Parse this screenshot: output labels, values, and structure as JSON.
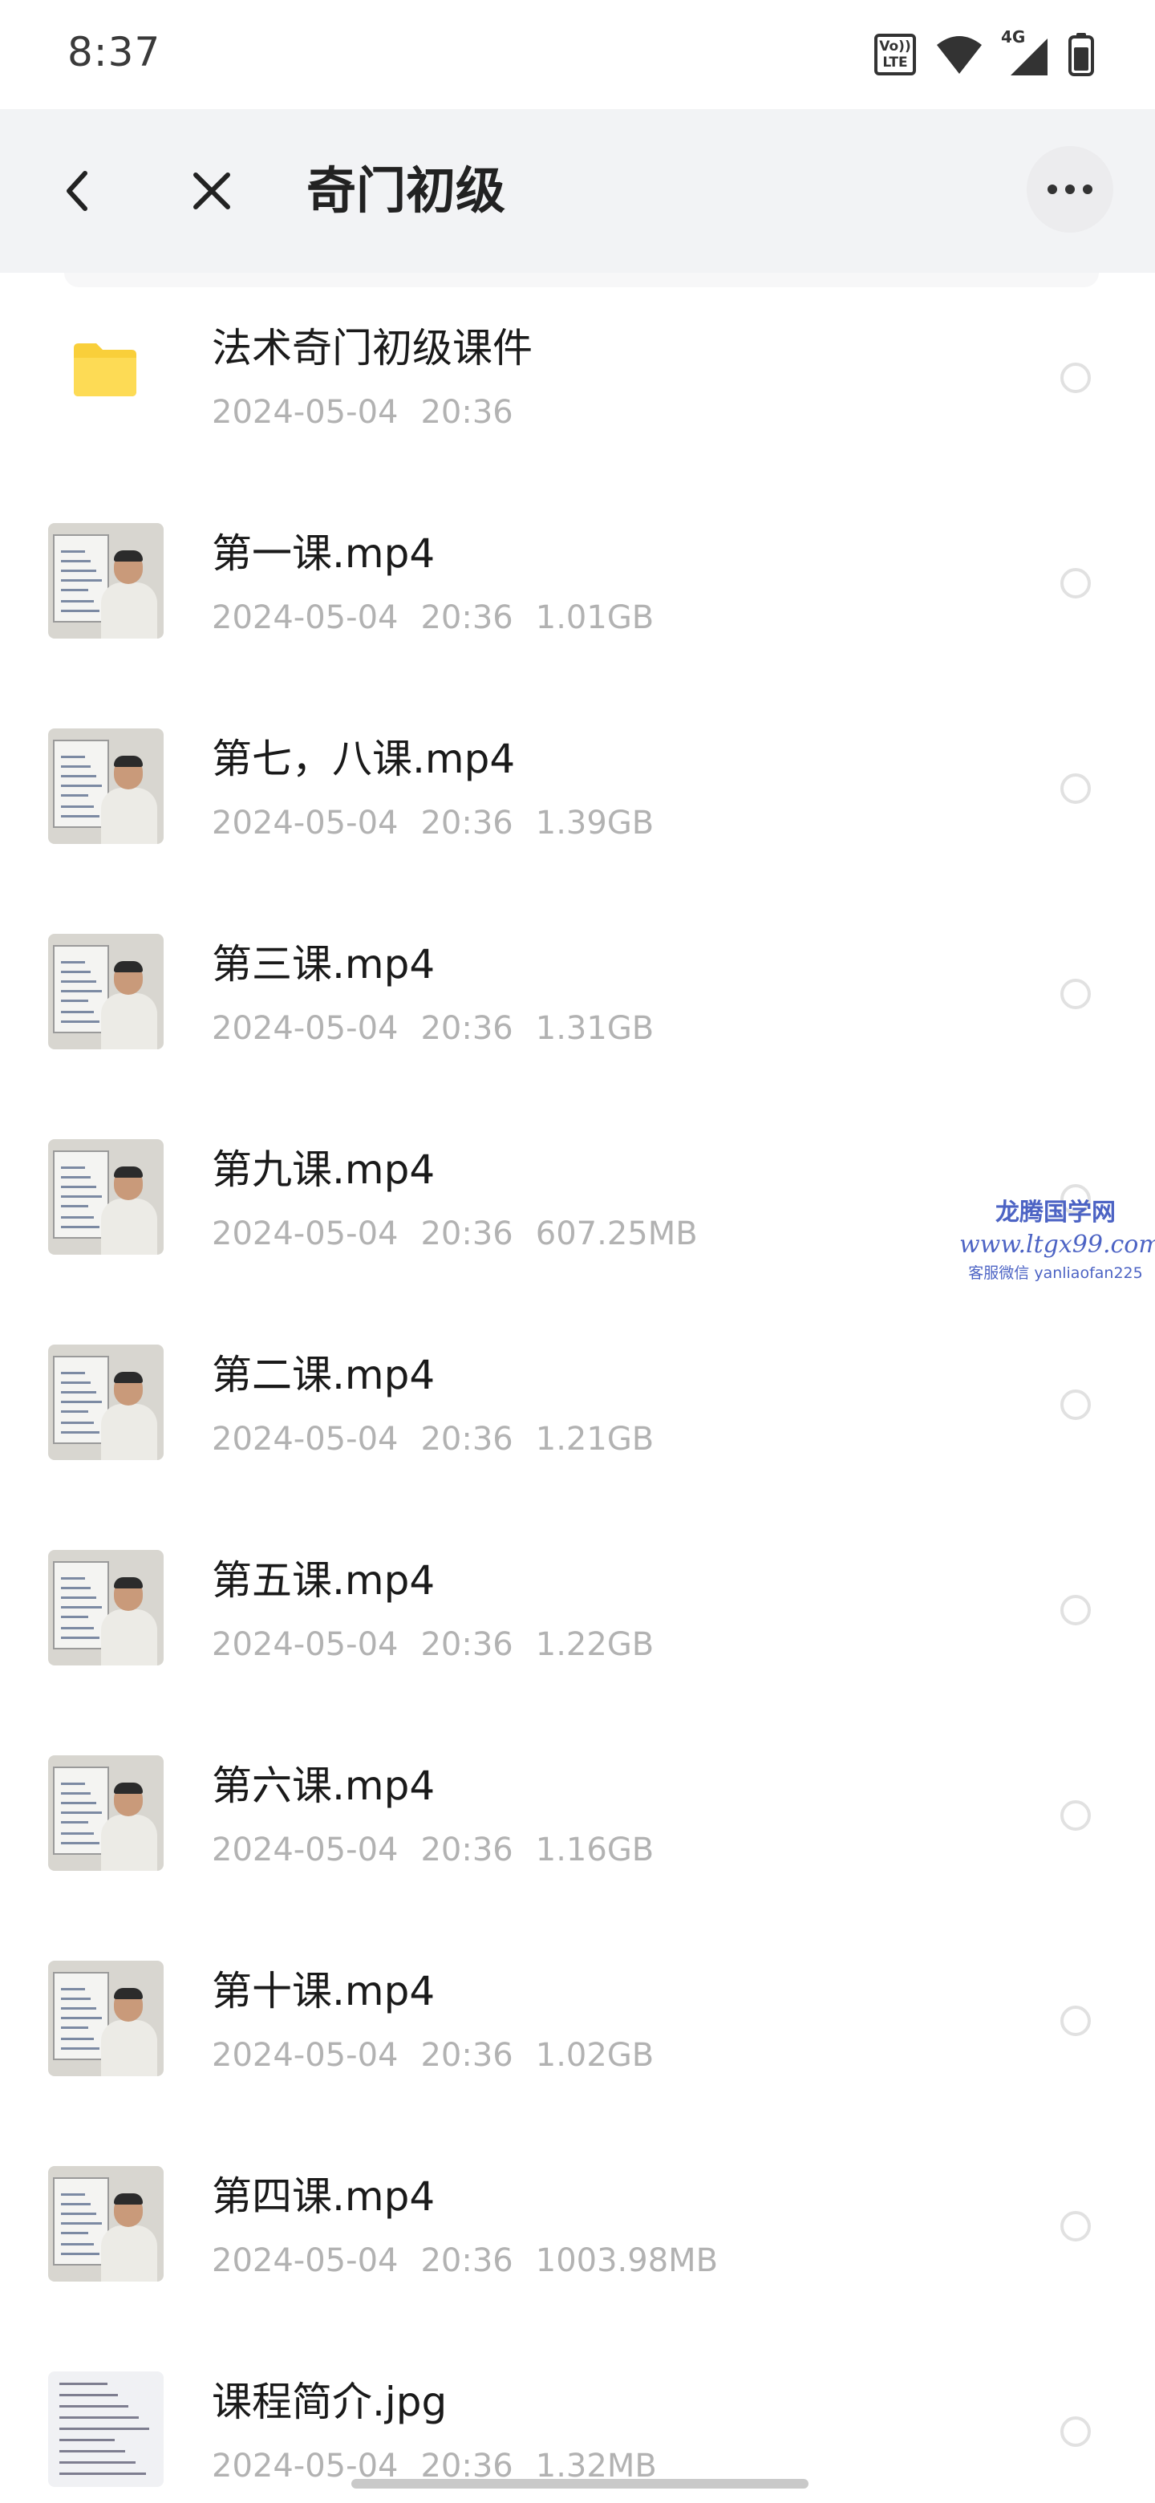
{
  "status_bar": {
    "time": "8:37",
    "volte_top": "Vo))",
    "volte_bottom": "LTE",
    "network_label": "4G",
    "icons": [
      "volte-icon",
      "wifi-icon",
      "signal-icon",
      "battery-icon"
    ]
  },
  "header": {
    "title": "奇门初级",
    "back_icon": "chevron-left-icon",
    "close_icon": "close-icon",
    "more_icon": "more-horizontal-icon"
  },
  "files": [
    {
      "type": "folder",
      "name": "法术奇门初级课件",
      "date": "2024-05-04",
      "time": "20:36",
      "size": ""
    },
    {
      "type": "video",
      "name": "第一课.mp4",
      "date": "2024-05-04",
      "time": "20:36",
      "size": "1.01GB"
    },
    {
      "type": "video",
      "name": "第七，八课.mp4",
      "date": "2024-05-04",
      "time": "20:36",
      "size": "1.39GB"
    },
    {
      "type": "video",
      "name": "第三课.mp4",
      "date": "2024-05-04",
      "time": "20:36",
      "size": "1.31GB"
    },
    {
      "type": "video",
      "name": "第九课.mp4",
      "date": "2024-05-04",
      "time": "20:36",
      "size": "607.25MB"
    },
    {
      "type": "video",
      "name": "第二课.mp4",
      "date": "2024-05-04",
      "time": "20:36",
      "size": "1.21GB"
    },
    {
      "type": "video",
      "name": "第五课.mp4",
      "date": "2024-05-04",
      "time": "20:36",
      "size": "1.22GB"
    },
    {
      "type": "video",
      "name": "第六课.mp4",
      "date": "2024-05-04",
      "time": "20:36",
      "size": "1.16GB"
    },
    {
      "type": "video",
      "name": "第十课.mp4",
      "date": "2024-05-04",
      "time": "20:36",
      "size": "1.02GB"
    },
    {
      "type": "video",
      "name": "第四课.mp4",
      "date": "2024-05-04",
      "time": "20:36",
      "size": "1003.98MB"
    },
    {
      "type": "image",
      "name": "课程简介.jpg",
      "date": "2024-05-04",
      "time": "20:36",
      "size": "1.32MB"
    }
  ],
  "watermark": {
    "line1": "龙腾国学网",
    "line2": "www.ltgx99.com",
    "line3": "客服微信 yanliaofan225"
  },
  "colors": {
    "header_bg": "#f2f3f5",
    "folder": "#f9cf3a",
    "meta_text": "#b2b2b2",
    "watermark": "#4c63c4"
  }
}
